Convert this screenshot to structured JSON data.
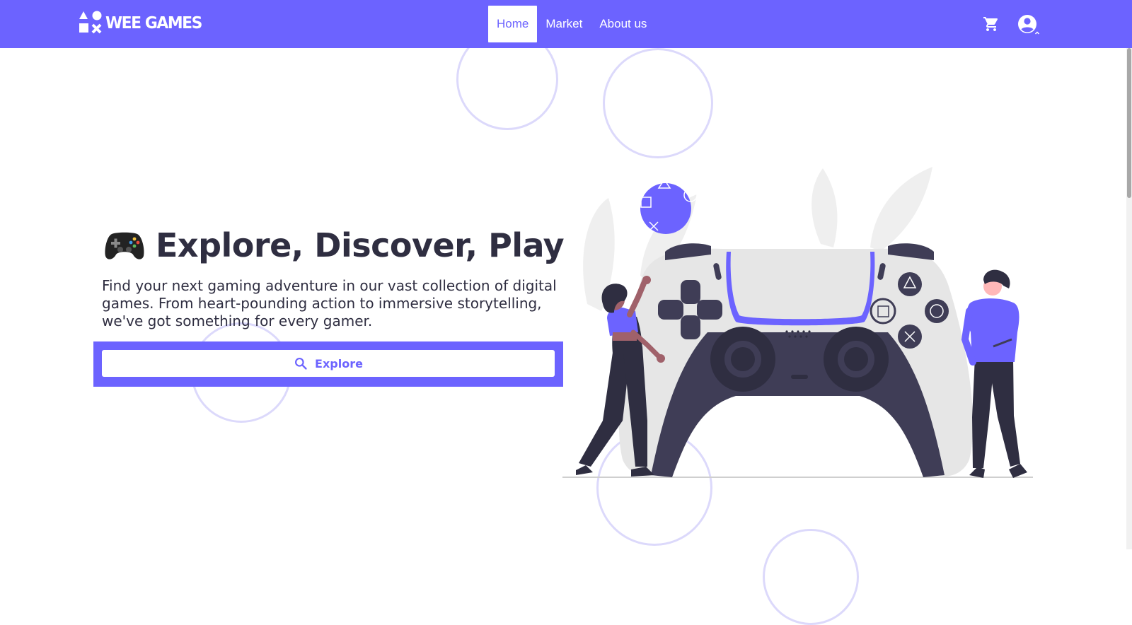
{
  "brand": {
    "name": "WEE GAMES",
    "logo_icon": "shapes-logo-icon"
  },
  "nav": {
    "items": [
      {
        "label": "Home",
        "active": true
      },
      {
        "label": "Market",
        "active": false
      },
      {
        "label": "About us",
        "active": false
      }
    ],
    "cart_icon": "cart-icon",
    "user_icon": "account-circle-icon"
  },
  "hero": {
    "title": "Explore, Discover, Play",
    "title_icon": "game-controller-emoji-icon",
    "description": "Find your next gaming adventure in our vast collection of digital games. From heart-pounding action to immersive storytelling, we've got something for every gamer.",
    "button_label": "Explore",
    "button_icon": "search-icon"
  },
  "colors": {
    "primary": "#6c63ff",
    "dark": "#2f2e41",
    "controller": "#e6e6e6",
    "circle": "#dcd9fb"
  }
}
